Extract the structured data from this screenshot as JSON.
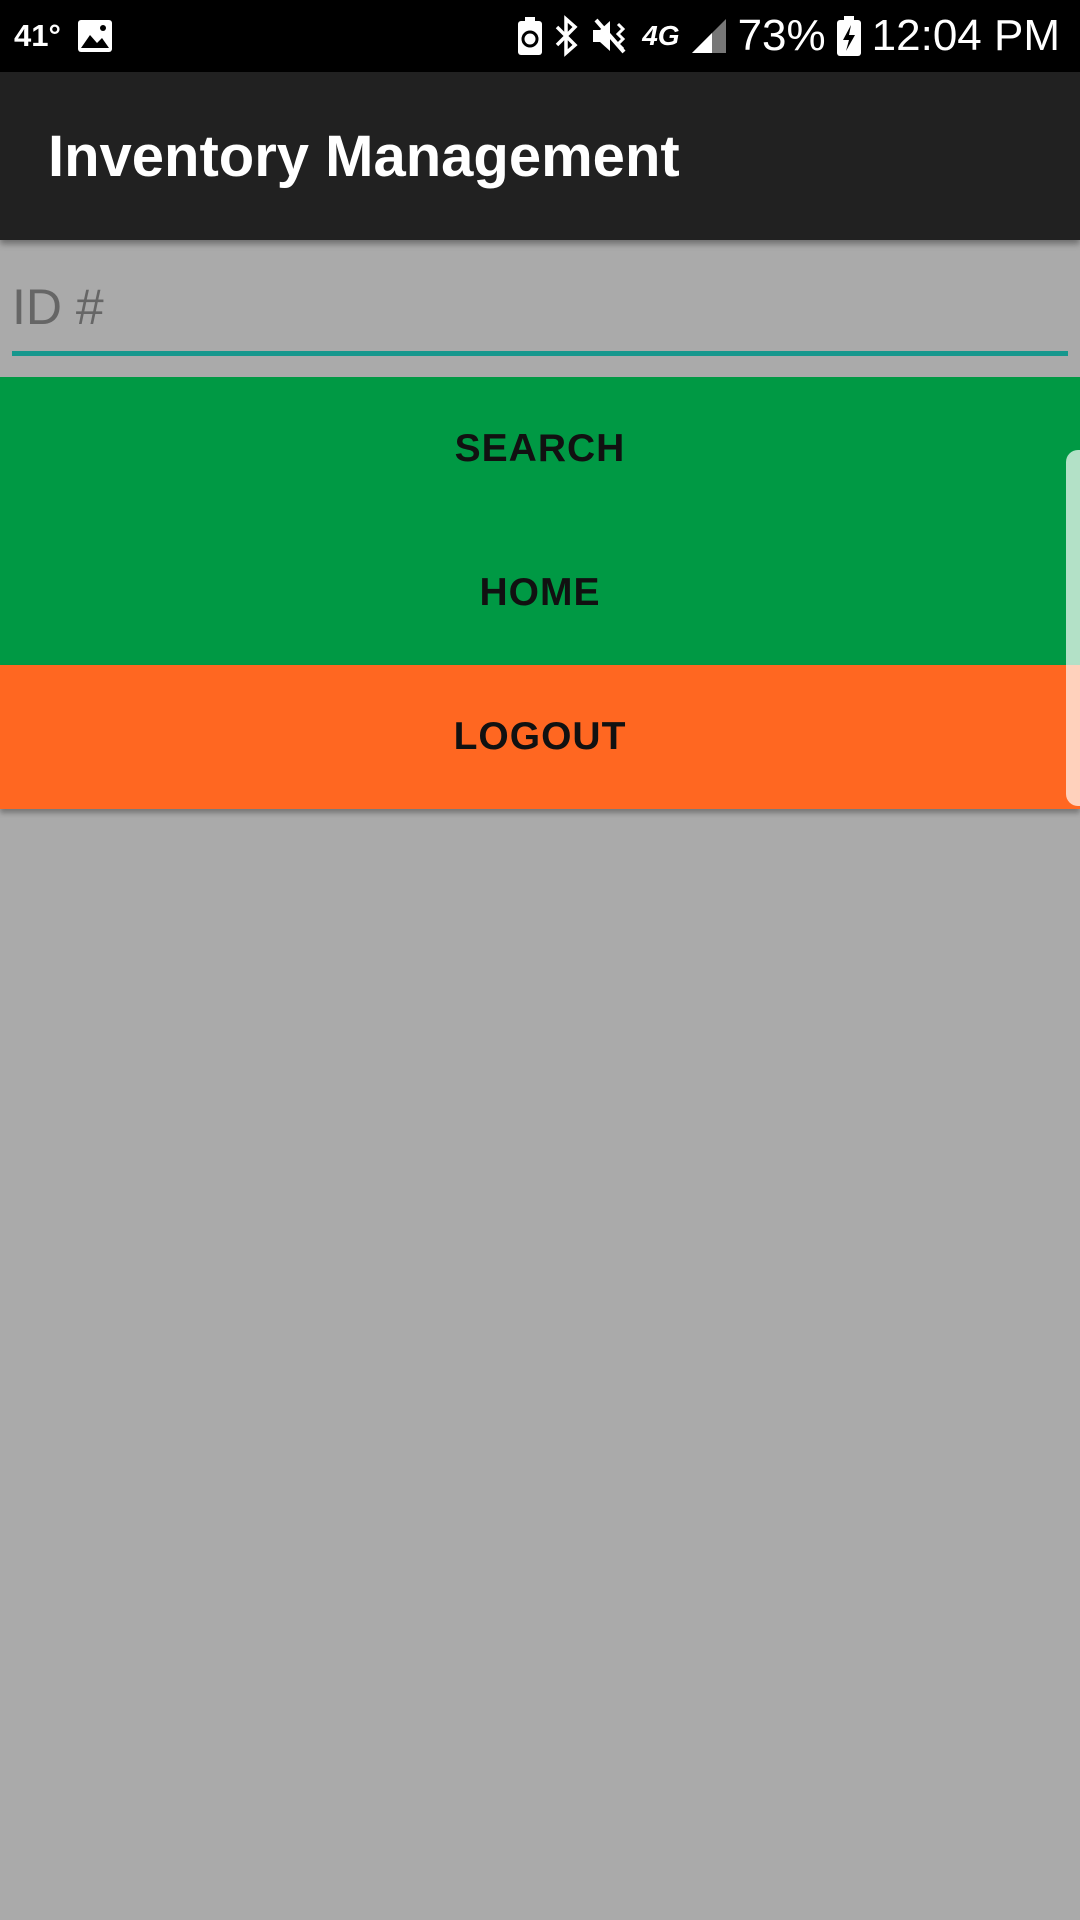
{
  "status_bar": {
    "temperature": "41°",
    "battery_percent": "73%",
    "time": "12:04 PM",
    "network_label": "4G",
    "icons": [
      "gallery-icon",
      "battery-saver-icon",
      "bluetooth-icon",
      "vibrate-mute-icon",
      "lte-icon",
      "signal-icon",
      "battery-charging-icon"
    ]
  },
  "app_bar": {
    "title": "Inventory Management"
  },
  "form": {
    "id_placeholder": "ID #",
    "id_value": ""
  },
  "buttons": {
    "search": "SEARCH",
    "home": "HOME",
    "logout": "LOGOUT"
  },
  "colors": {
    "app_bar": "#212121",
    "background": "#aaaaaa",
    "accent_underline": "#16978d",
    "search_button": "#009944",
    "home_button": "#009944",
    "logout_button": "#ff6721"
  }
}
